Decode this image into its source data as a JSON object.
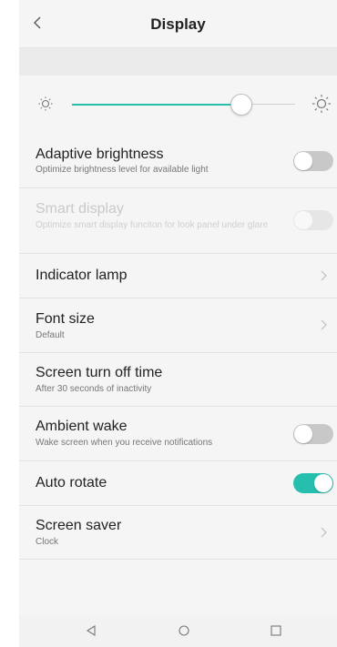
{
  "header": {
    "title": "Display",
    "back_icon": "chevron-left-icon"
  },
  "brightness": {
    "level_percent": 76,
    "low_icon": "brightness-low-icon",
    "high_icon": "brightness-high-icon",
    "accent": "#26bfae"
  },
  "settings": [
    {
      "label": "Adaptive brightness",
      "sub": "Optimize brightness level for available light",
      "control": "toggle",
      "state": "off",
      "enabled": true
    },
    {
      "label": "Smart display",
      "sub": "Optimize smart display funciton for look panel under glare",
      "control": "toggle",
      "state": "off",
      "enabled": false
    },
    {
      "label": "Indicator lamp",
      "sub": "",
      "control": "chevron",
      "enabled": true
    },
    {
      "label": "Font size",
      "sub": "Default",
      "control": "chevron",
      "enabled": true
    },
    {
      "label": "Screen turn off time",
      "sub": "After 30 seconds of inactivity",
      "control": "none",
      "enabled": true
    },
    {
      "label": "Ambient wake",
      "sub": "Wake screen when you receive notifications",
      "control": "toggle",
      "state": "off",
      "enabled": true
    },
    {
      "label": "Auto rotate",
      "sub": "",
      "control": "toggle",
      "state": "on",
      "enabled": true
    },
    {
      "label": "Screen saver",
      "sub": "Clock",
      "control": "chevron",
      "enabled": true
    }
  ],
  "navbar": {
    "back": "back-triangle-icon",
    "home": "home-circle-icon",
    "recents": "recents-square-icon"
  }
}
